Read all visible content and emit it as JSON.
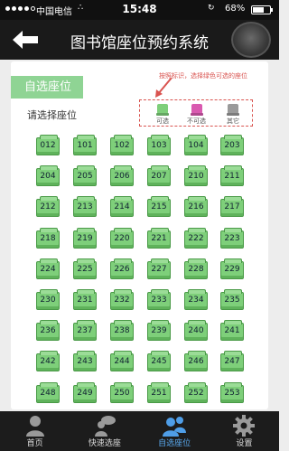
{
  "status_bar": {
    "carrier": "中国电信",
    "time": "15:48",
    "battery": "68%",
    "battery_level": 0.68
  },
  "nav": {
    "title": "图书馆座位预约系统"
  },
  "panel": {
    "section_title": "自选座位",
    "choose_label": "请选择座位",
    "callout": "按照标识，选择绿色可选的座位",
    "legend": [
      {
        "label": "可选",
        "color": "#7ecf7a"
      },
      {
        "label": "不可选",
        "color": "#d95ab0"
      },
      {
        "label": "其它",
        "color": "#9a9a9a"
      }
    ]
  },
  "seats": [
    [
      "012",
      "101",
      "102",
      "103",
      "104",
      "203"
    ],
    [
      "204",
      "205",
      "206",
      "207",
      "210",
      "211"
    ],
    [
      "212",
      "213",
      "214",
      "215",
      "216",
      "217"
    ],
    [
      "218",
      "219",
      "220",
      "221",
      "222",
      "223"
    ],
    [
      "224",
      "225",
      "226",
      "227",
      "228",
      "229"
    ],
    [
      "230",
      "231",
      "232",
      "233",
      "234",
      "235"
    ],
    [
      "236",
      "237",
      "238",
      "239",
      "240",
      "241"
    ],
    [
      "242",
      "243",
      "244",
      "245",
      "246",
      "247"
    ],
    [
      "248",
      "249",
      "250",
      "251",
      "252",
      "253"
    ]
  ],
  "tabs": [
    {
      "label": "首页",
      "icon": "person-icon"
    },
    {
      "label": "快速选座",
      "icon": "chat-person-icon"
    },
    {
      "label": "自选座位",
      "icon": "people-icon"
    },
    {
      "label": "设置",
      "icon": "gear-icon"
    }
  ],
  "active_tab": 2
}
